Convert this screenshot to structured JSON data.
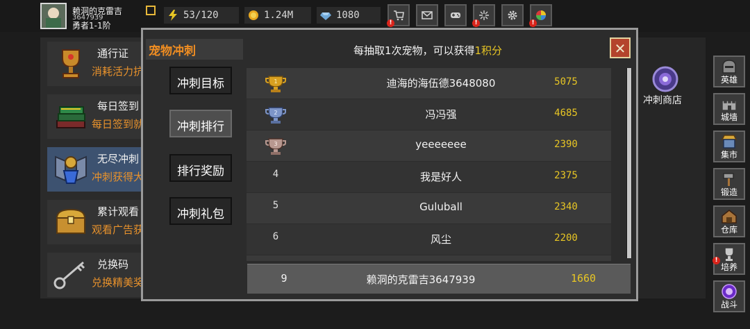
{
  "player": {
    "name": "赖洞的克雷吉",
    "id": "3647939",
    "rank": "勇者1-1阶"
  },
  "resources": {
    "energy": "53/120",
    "gold": "1.24M",
    "gems": "1080"
  },
  "toolbar": {
    "icons": [
      "cart-icon",
      "mail-icon",
      "gamepad-icon",
      "firework-icon",
      "gear-icon",
      "ball-icon"
    ],
    "alerts": {
      "cart": "!",
      "firework": "!",
      "ball": "!"
    }
  },
  "left_panel": {
    "items": [
      {
        "title": "通行证",
        "subtitle": "消耗活力抗"
      },
      {
        "title": "每日签到",
        "subtitle": "每日签到就"
      },
      {
        "title": "无尽冲刺",
        "subtitle": "冲刺获得大"
      },
      {
        "title": "累计观看",
        "subtitle": "观看广告获"
      },
      {
        "title": "兑换码",
        "subtitle": "兑换精美奖"
      }
    ]
  },
  "right_panel": {
    "shop_label": "冲刺商店"
  },
  "sidebar": {
    "items": [
      "英雄",
      "城墙",
      "集市",
      "锻造",
      "仓库",
      "培养",
      "战斗"
    ]
  },
  "modal": {
    "title": "宠物冲刺",
    "info_prefix": "每抽取1次宠物，可以获得",
    "info_highlight": "1积分",
    "close": "✕",
    "tabs": [
      "冲刺目标",
      "冲刺排行",
      "排行奖励",
      "冲刺礼包"
    ],
    "active_tab": "冲刺排行",
    "ranking": [
      {
        "rank": "1",
        "name": "迪海的海伍德3648080",
        "score": "5075"
      },
      {
        "rank": "2",
        "name": "冯冯强",
        "score": "4685"
      },
      {
        "rank": "3",
        "name": "yeeeeeee",
        "score": "2390"
      },
      {
        "rank": "4",
        "name": "我是好人",
        "score": "2375"
      },
      {
        "rank": "5",
        "name": "Guluball",
        "score": "2340"
      },
      {
        "rank": "6",
        "name": "风尘",
        "score": "2200"
      }
    ],
    "me": {
      "rank": "9",
      "name": "赖洞的克雷吉3647939",
      "score": "1660"
    }
  },
  "colors": {
    "title_orange": "#ef8d22",
    "score_yellow": "#e8c624",
    "gold_cup": "#d8a020",
    "silver_cup": "#7d95c8",
    "bronze_cup": "#b89890"
  }
}
